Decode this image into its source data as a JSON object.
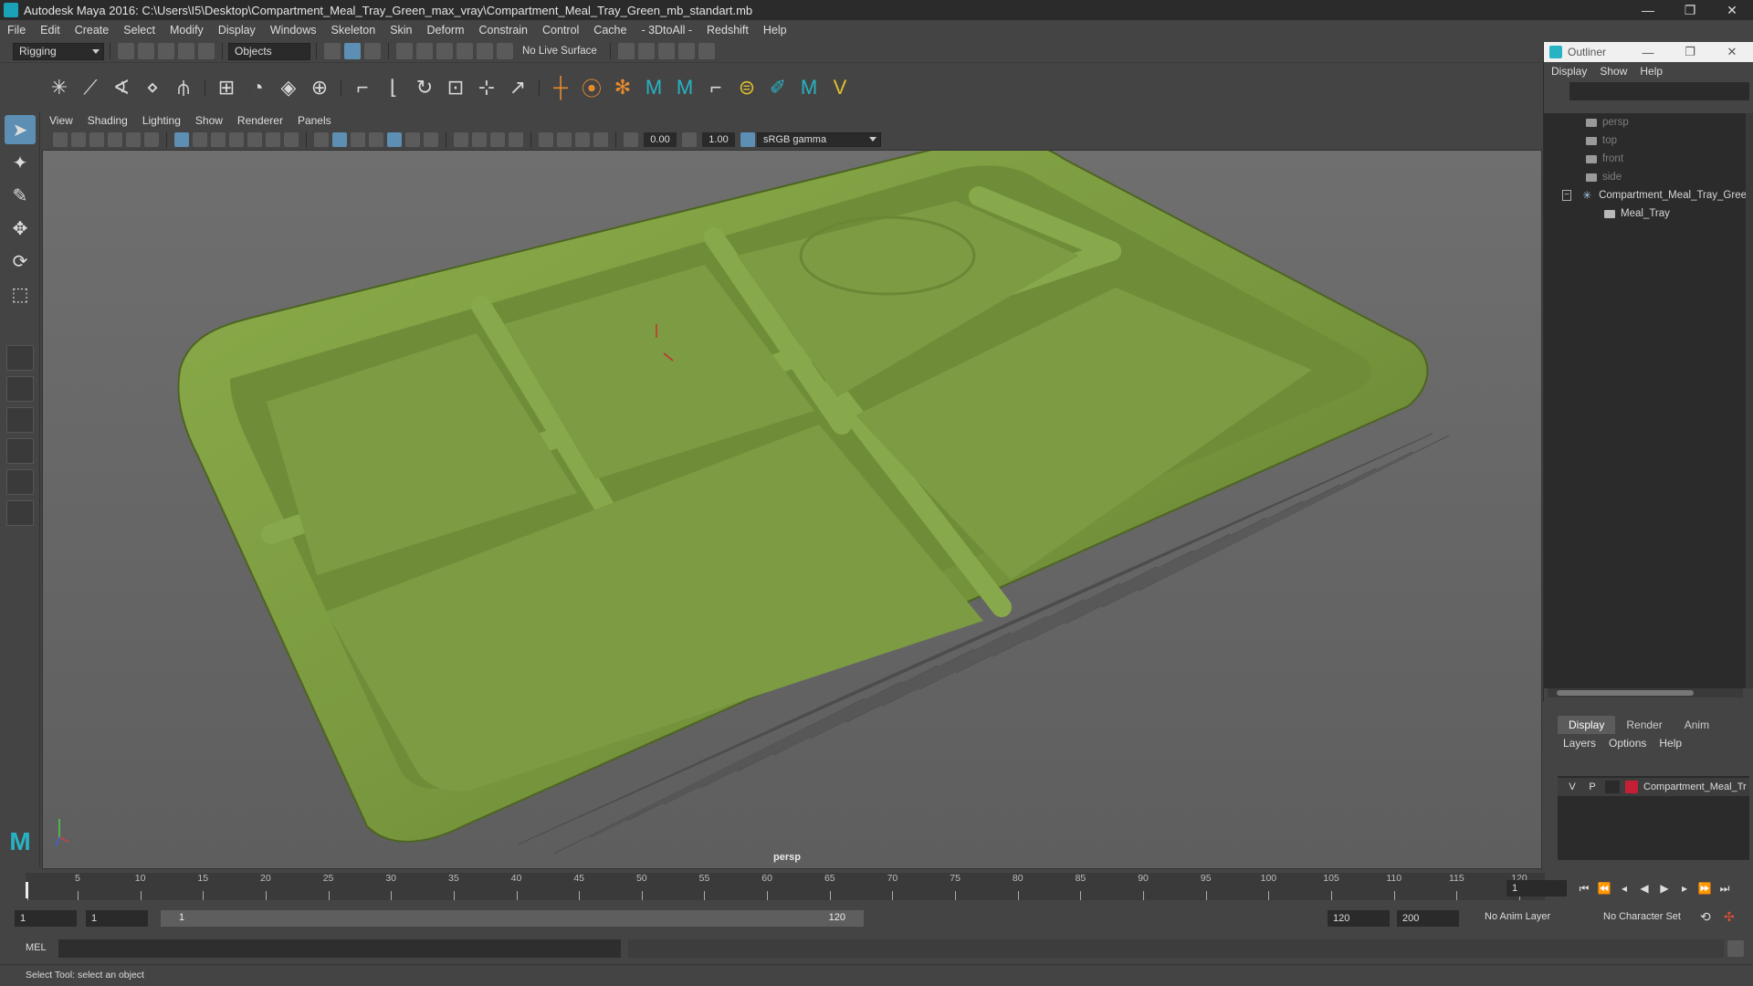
{
  "window": {
    "title": "Autodesk Maya 2016: C:\\Users\\I5\\Desktop\\Compartment_Meal_Tray_Green_max_vray\\Compartment_Meal_Tray_Green_mb_standart.mb",
    "minimize": "—",
    "restore": "❐",
    "close": "✕"
  },
  "menubar": [
    "File",
    "Edit",
    "Create",
    "Select",
    "Modify",
    "Display",
    "Windows",
    "Skeleton",
    "Skin",
    "Deform",
    "Constrain",
    "Control",
    "Cache",
    "- 3DtoAll -",
    "Redshift",
    "Help"
  ],
  "statusline": {
    "mode": "Rigging",
    "selection_mode": "Objects",
    "live_surface": "No Live Surface"
  },
  "viewport": {
    "menu": [
      "View",
      "Shading",
      "Lighting",
      "Show",
      "Renderer",
      "Panels"
    ],
    "exposure": "0.00",
    "gamma": "1.00",
    "colorspace": "sRGB gamma",
    "camera": "persp",
    "tray_color": "#7b9a40"
  },
  "outliner": {
    "title": "Outliner",
    "menu": [
      "Display",
      "Show",
      "Help"
    ],
    "nodes": [
      {
        "label": "persp",
        "kind": "camera",
        "dim": true
      },
      {
        "label": "top",
        "kind": "camera",
        "dim": true
      },
      {
        "label": "front",
        "kind": "camera",
        "dim": true
      },
      {
        "label": "side",
        "kind": "camera",
        "dim": true
      },
      {
        "label": "Compartment_Meal_Tray_Gree",
        "kind": "group",
        "dim": false
      },
      {
        "label": "Meal_Tray",
        "kind": "mesh",
        "dim": false
      }
    ]
  },
  "layers": {
    "tabs": [
      "Display",
      "Render",
      "Anim"
    ],
    "menu": [
      "Layers",
      "Options",
      "Help"
    ],
    "row": {
      "v": "V",
      "p": "P",
      "name": "Compartment_Meal_Tr",
      "color": "#c41f35"
    }
  },
  "timeline": {
    "ticks": [
      1,
      5,
      10,
      15,
      20,
      25,
      30,
      35,
      40,
      45,
      50,
      55,
      60,
      65,
      70,
      75,
      80,
      85,
      90,
      95,
      100,
      105,
      110,
      115,
      120
    ],
    "current_frame": "1"
  },
  "range": {
    "start": "1",
    "anim_start": "1",
    "range_start_label": "1",
    "range_end_label": "120",
    "end": "120",
    "anim_end": "200",
    "anim_layer": "No Anim Layer",
    "character_set": "No Character Set"
  },
  "command": {
    "label": "MEL",
    "help": "Select Tool: select an object"
  }
}
